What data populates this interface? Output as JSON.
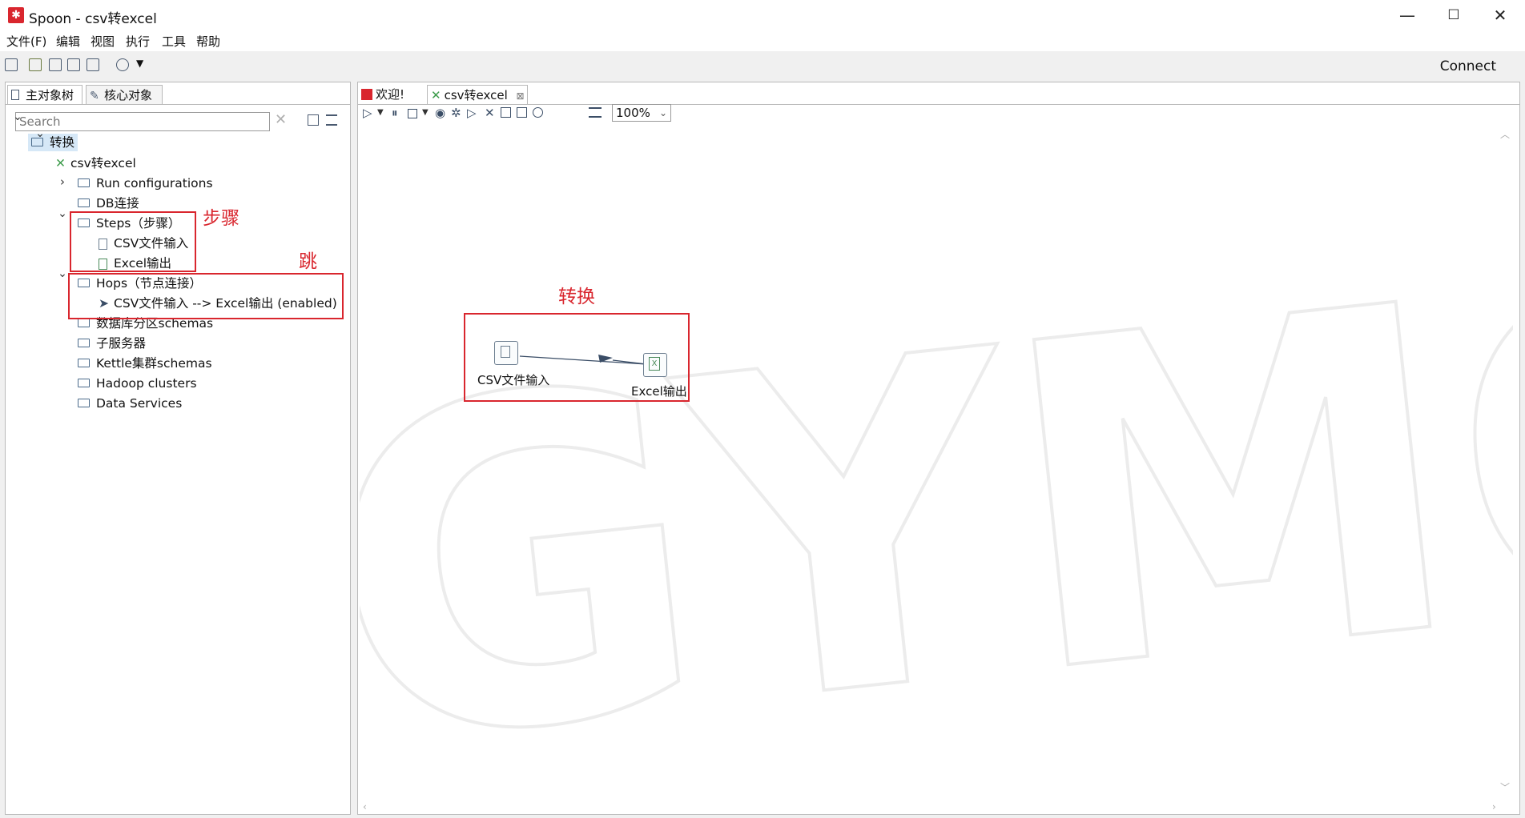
{
  "window": {
    "title": "Spoon - csv转excel",
    "min": "—",
    "max": "☐",
    "close": "✕"
  },
  "menu": [
    "文件(F)",
    "编辑",
    "视图",
    "执行",
    "工具",
    "帮助"
  ],
  "toolbar": {
    "connect": "Connect"
  },
  "left_tabs": [
    "主对象树",
    "核心对象"
  ],
  "search": {
    "placeholder": "Search",
    "value": ""
  },
  "tree": {
    "root": "转换",
    "transform": "csv转excel",
    "run_configurations": "Run configurations",
    "db": "DB连接",
    "steps": "Steps（步骤）",
    "step_csv": "CSV文件输入",
    "step_excel": "Excel输出",
    "hops": "Hops（节点连接）",
    "hop_item": "CSV文件输入 --> Excel输出 (enabled)",
    "partition": "数据库分区schemas",
    "slave": "子服务器",
    "cluster": "Kettle集群schemas",
    "hadoop": "Hadoop clusters",
    "data_services": "Data Services"
  },
  "annotations": {
    "steps": "步骤",
    "hop": "跳",
    "transform": "转换"
  },
  "right_tabs": {
    "welcome": "欢迎!",
    "active": "csv转excel"
  },
  "zoom": "100%",
  "canvas": {
    "step1": "CSV文件输入",
    "step2": "Excel输出"
  },
  "colors": {
    "accent_red": "#d9262e"
  }
}
